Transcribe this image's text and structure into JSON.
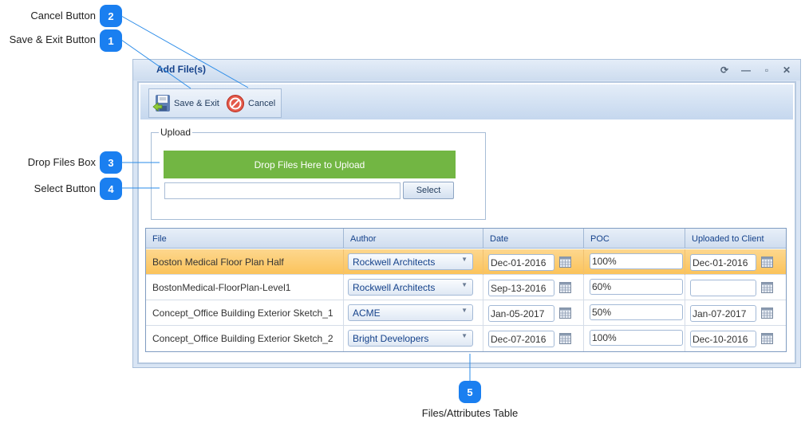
{
  "callouts": [
    {
      "number": "2",
      "label": "Cancel Button"
    },
    {
      "number": "1",
      "label": "Save & Exit Button"
    },
    {
      "number": "3",
      "label": "Drop Files Box"
    },
    {
      "number": "4",
      "label": "Select Button"
    },
    {
      "number": "5",
      "label": "Files/Attributes Table"
    }
  ],
  "window": {
    "title": "Add File(s)",
    "controls": {
      "refresh": "refresh-icon",
      "minimize": "minimize-icon",
      "maximize": "maximize-icon",
      "close": "close-icon"
    }
  },
  "toolbar": {
    "save_label": "Save & Exit",
    "cancel_label": "Cancel"
  },
  "upload": {
    "group_label": "Upload",
    "drop_label": "Drop Files Here to Upload",
    "file_path_value": "",
    "select_label": "Select",
    "drop_color": "#72b643"
  },
  "table": {
    "columns": [
      "File",
      "Author",
      "Date",
      "POC",
      "Uploaded to Client"
    ],
    "rows": [
      {
        "file": "Boston Medical Floor Plan Half",
        "author": "Rockwell Architects",
        "date": "Dec-01-2016",
        "poc": "100%",
        "uploaded": "Dec-01-2016",
        "selected": true
      },
      {
        "file": "BostonMedical-FloorPlan-Level1",
        "author": "Rockwell Architects",
        "date": "Sep-13-2016",
        "poc": "60%",
        "uploaded": "",
        "selected": false
      },
      {
        "file": "Concept_Office Building Exterior Sketch_1",
        "author": "ACME",
        "date": "Jan-05-2017",
        "poc": "50%",
        "uploaded": "Jan-07-2017",
        "selected": false
      },
      {
        "file": "Concept_Office Building Exterior Sketch_2",
        "author": "Bright Developers",
        "date": "Dec-07-2016",
        "poc": "100%",
        "uploaded": "Dec-10-2016",
        "selected": false
      }
    ]
  }
}
